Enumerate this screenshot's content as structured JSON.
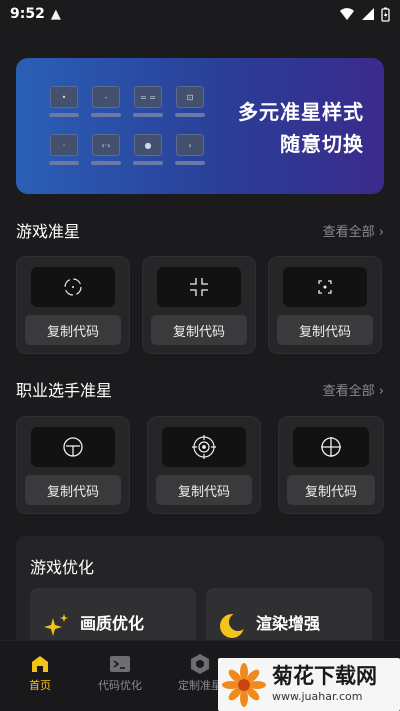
{
  "status": {
    "time": "9:52",
    "alert_icon": "warning-icon"
  },
  "banner": {
    "line1": "多元准星样式",
    "line2": "随意切换"
  },
  "game_section": {
    "title": "游戏准星",
    "more": "查看全部 ›"
  },
  "game_cards": [
    {
      "icon": "circle-crosshair-icon",
      "button": "复制代码"
    },
    {
      "icon": "corner-crosshair-icon",
      "button": "复制代码"
    },
    {
      "icon": "bracket-crosshair-icon",
      "button": "复制代码"
    }
  ],
  "pro_section": {
    "title": "职业选手准星",
    "more": "查看全部 ›"
  },
  "pro_cards": [
    {
      "icon": "t-circle-crosshair-icon",
      "button": "复制代码"
    },
    {
      "icon": "target-crosshair-icon",
      "button": "复制代码"
    },
    {
      "icon": "cross-circle-crosshair-icon",
      "button": "复制代码"
    }
  ],
  "optimize": {
    "title": "游戏优化",
    "items": [
      {
        "label": "画质优化",
        "icon": "sparkle-icon"
      },
      {
        "label": "渲染增强",
        "icon": "moon-icon"
      }
    ]
  },
  "nav": [
    {
      "label": "首页",
      "icon": "home-icon",
      "active": true
    },
    {
      "label": "代码优化",
      "icon": "terminal-icon",
      "active": false
    },
    {
      "label": "定制准星",
      "icon": "hexagon-icon",
      "active": false
    }
  ],
  "watermark": {
    "text": "菊花下载网",
    "url": "www.juahar.com"
  },
  "colors": {
    "accent": "#f3c31a",
    "background": "#1b1b1d",
    "card": "#262628"
  }
}
